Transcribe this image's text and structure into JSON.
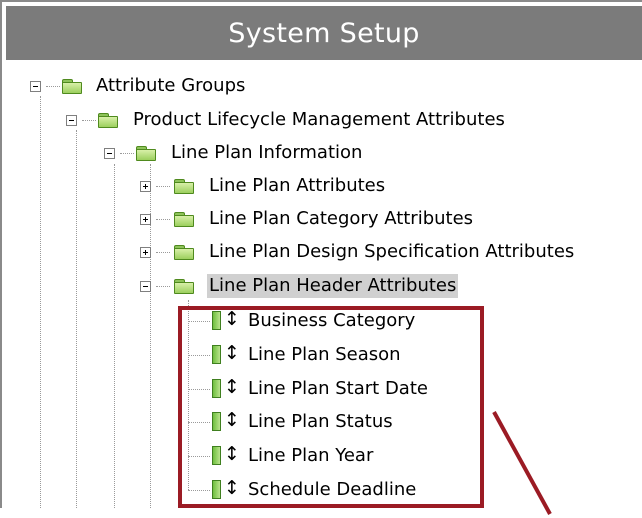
{
  "title": "System Setup",
  "tree": {
    "root": {
      "label": "Attribute Groups",
      "state": "expanded"
    },
    "plm": {
      "label": "Product Lifecycle Management Attributes",
      "state": "expanded"
    },
    "lpi": {
      "label": "Line Plan Information",
      "state": "expanded"
    },
    "groups": [
      {
        "label": "Line Plan Attributes",
        "state": "collapsed"
      },
      {
        "label": "Line Plan Category Attributes",
        "state": "collapsed"
      },
      {
        "label": "Line Plan Design Specification Attributes",
        "state": "collapsed"
      },
      {
        "label": "Line Plan Header Attributes",
        "state": "expanded",
        "selected": true
      }
    ],
    "attributes": [
      "Business Category",
      "Line Plan Season",
      "Line Plan Start Date",
      "Line Plan Status",
      "Line Plan Year",
      "Schedule Deadline"
    ]
  },
  "colors": {
    "title_bg": "#7b7b7b",
    "highlight": "#9b1b24",
    "selection": "#d0d0d0",
    "folder_green": "#9ccf5e"
  }
}
